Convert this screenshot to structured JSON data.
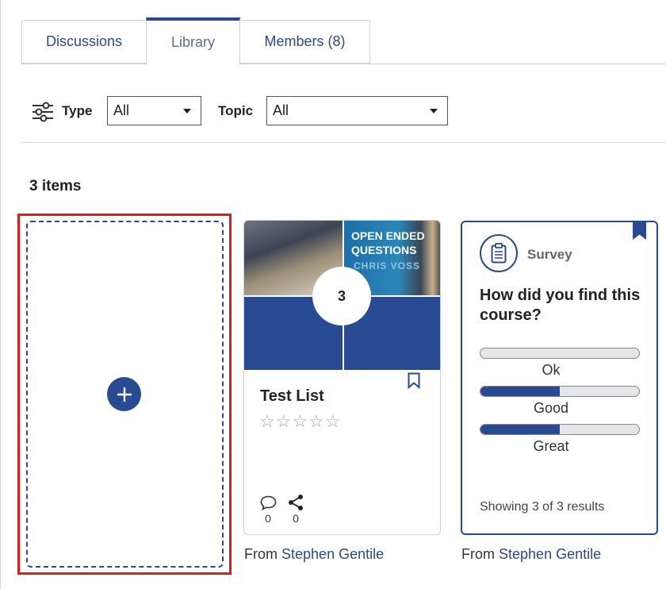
{
  "tabs": [
    {
      "label": "Discussions"
    },
    {
      "label": "Library"
    },
    {
      "label": "Members (8)"
    }
  ],
  "filters": {
    "type_label": "Type",
    "type_value": "All",
    "topic_label": "Topic",
    "topic_value": "All"
  },
  "item_count": "3 items",
  "list_card": {
    "thumb_text_line1": "OPEN ENDED",
    "thumb_text_line2": "QUESTIONS",
    "thumb_subtext": "CHRIS VOSS",
    "count": "3",
    "title": "Test List",
    "stars": "☆☆☆☆☆",
    "comments": "0",
    "shares": "0",
    "from_prefix": "From",
    "author": "Stephen Gentile"
  },
  "survey_card": {
    "type": "Survey",
    "question": "How did you find this course?",
    "options": [
      {
        "label": "Ok",
        "fraction": 0
      },
      {
        "label": "Good",
        "fraction": 0.5
      },
      {
        "label": "Great",
        "fraction": 0.5
      }
    ],
    "results": "Showing 3 of 3 results",
    "from_prefix": "From",
    "author": "Stephen Gentile"
  },
  "colors": {
    "accent": "#274a93",
    "highlight": "#e01b1b"
  }
}
